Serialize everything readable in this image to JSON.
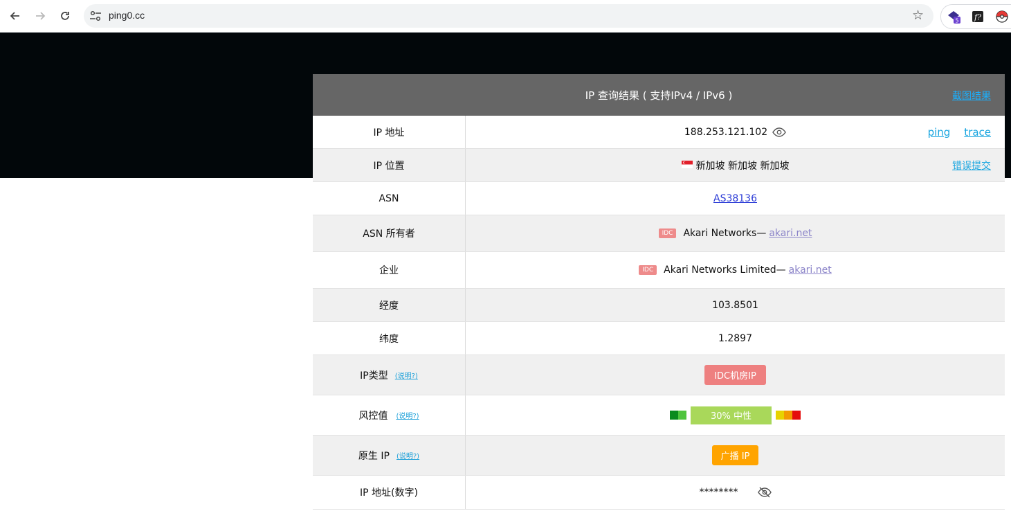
{
  "browser": {
    "url": "ping0.cc",
    "extensions": [
      "shield-extension-icon",
      "fx-extension-icon",
      "pokeball-extension-icon"
    ],
    "ext_badge": "5"
  },
  "panel": {
    "title": "IP 查询结果 ( 支持IPv4 / IPv6 )",
    "screenshot_link": "截图结果"
  },
  "rows": {
    "ip": {
      "label": "IP 地址",
      "value": "188.253.121.102",
      "ping": "ping",
      "trace": "trace"
    },
    "location": {
      "label": "IP 位置",
      "flag": "🇸🇬",
      "value": "新加坡 新加坡 新加坡",
      "report": "错误提交"
    },
    "asn": {
      "label": "ASN",
      "value": "AS38136"
    },
    "asn_owner": {
      "label": "ASN 所有者",
      "badge": "IDC",
      "name": "Akari Networks—",
      "site": "akari.net"
    },
    "org": {
      "label": "企业",
      "badge": "IDC",
      "name": "Akari Networks Limited—",
      "site": "akari.net"
    },
    "longitude": {
      "label": "经度",
      "value": "103.8501"
    },
    "latitude": {
      "label": "纬度",
      "value": "1.2897"
    },
    "ip_type": {
      "label": "IP类型",
      "help": "(说明?)",
      "value": "IDC机房IP"
    },
    "risk": {
      "label": "风控值",
      "help": "(说明?)",
      "value": "30%  中性",
      "percent": 30
    },
    "native_ip": {
      "label": "原生 IP",
      "help": "(说明?)",
      "value": "广播 IP"
    },
    "ip_numeric": {
      "label": "IP 地址(数字)",
      "value": "********"
    }
  },
  "colors": {
    "accent_link": "#1aa6e0",
    "header_bg": "#666666",
    "idc_badge": "#ee8b8b",
    "risk_green": "#a9d85a",
    "native_orange": "#ffa400"
  }
}
